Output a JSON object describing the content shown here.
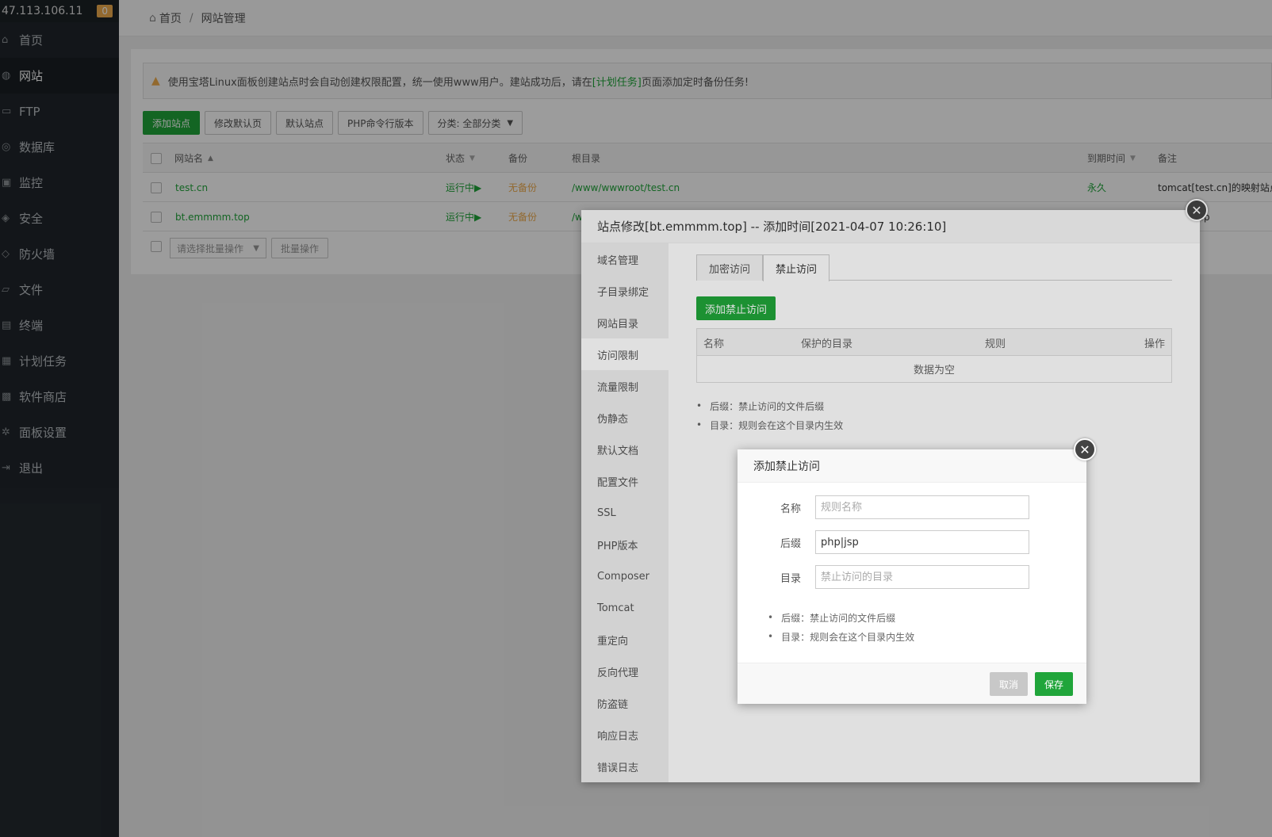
{
  "sidebar": {
    "ip": "47.113.106.11",
    "badge": "0",
    "items": [
      {
        "label": "首页",
        "icon": "home-icon"
      },
      {
        "label": "网站",
        "icon": "globe-icon"
      },
      {
        "label": "FTP",
        "icon": "ftp-icon"
      },
      {
        "label": "数据库",
        "icon": "database-icon"
      },
      {
        "label": "监控",
        "icon": "monitor-icon"
      },
      {
        "label": "安全",
        "icon": "shield-icon"
      },
      {
        "label": "防火墙",
        "icon": "firewall-icon"
      },
      {
        "label": "文件",
        "icon": "folder-icon"
      },
      {
        "label": "终端",
        "icon": "terminal-icon"
      },
      {
        "label": "计划任务",
        "icon": "calendar-icon"
      },
      {
        "label": "软件商店",
        "icon": "apps-icon"
      },
      {
        "label": "面板设置",
        "icon": "gear-icon"
      },
      {
        "label": "退出",
        "icon": "logout-icon"
      }
    ]
  },
  "breadcrumb": {
    "home": "首页",
    "sep": "/",
    "current": "网站管理"
  },
  "notice": {
    "text_before": "使用宝塔Linux面板创建站点时会自动创建权限配置，统一使用www用户。建站成功后，请在",
    "link": "[计划任务]",
    "text_after": "页面添加定时备份任务!"
  },
  "toolbar": {
    "add_site": "添加站点",
    "edit_default": "修改默认页",
    "default_site": "默认站点",
    "php_cli": "PHP命令行版本",
    "category": "分类: 全部分类"
  },
  "table": {
    "columns": {
      "name": "网站名",
      "status": "状态",
      "backup": "备份",
      "root": "根目录",
      "expire": "到期时间",
      "note": "备注"
    },
    "rows": [
      {
        "name": "test.cn",
        "status": "运行中▶",
        "backup": "无备份",
        "root": "/www/wwwroot/test.cn",
        "expire": "永久",
        "note": "tomcat[test.cn]的映射站点"
      },
      {
        "name": "bt.emmmm.top",
        "status": "运行中▶",
        "backup": "无备份",
        "root": "/w",
        "expire": "",
        "note": "_top"
      }
    ]
  },
  "batch": {
    "select_placeholder": "请选择批量操作",
    "button": "批量操作"
  },
  "site_modal": {
    "title": "站点修改[bt.emmmm.top] -- 添加时间[2021-04-07 10:26:10]",
    "menu": [
      "域名管理",
      "子目录绑定",
      "网站目录",
      "访问限制",
      "流量限制",
      "伪静态",
      "默认文档",
      "配置文件",
      "SSL",
      "PHP版本",
      "Composer",
      "Tomcat",
      "重定向",
      "反向代理",
      "防盗链",
      "响应日志",
      "错误日志"
    ],
    "active_menu": "访问限制",
    "tabs": [
      "加密访问",
      "禁止访问"
    ],
    "active_tab": "禁止访问",
    "add_button": "添加禁止访问",
    "columns": {
      "name": "名称",
      "dir": "保护的目录",
      "rule": "规则",
      "op": "操作"
    },
    "empty": "数据为空",
    "notes": [
      "后缀：禁止访问的文件后缀",
      "目录：规则会在这个目录内生效"
    ]
  },
  "add_dialog": {
    "title": "添加禁止访问",
    "fields": {
      "name": {
        "label": "名称",
        "value": "",
        "placeholder": "规则名称"
      },
      "suffix": {
        "label": "后缀",
        "value": "php|jsp",
        "placeholder": ""
      },
      "dir": {
        "label": "目录",
        "value": "",
        "placeholder": "禁止访问的目录"
      }
    },
    "notes": [
      "后缀：禁止访问的文件后缀",
      "目录：规则会在这个目录内生效"
    ],
    "cancel": "取消",
    "save": "保存"
  },
  "colors": {
    "accent": "#20a53a",
    "warning": "#f0ad4e",
    "sidebar_bg": "#20262b"
  }
}
